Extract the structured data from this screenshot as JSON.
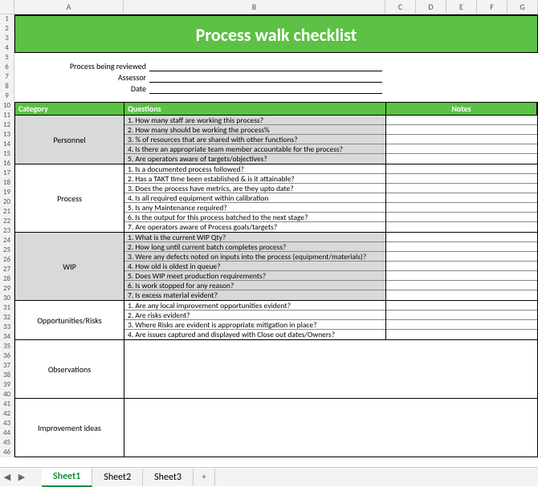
{
  "title": "Process walk checklist",
  "meta": {
    "reviewed_label": "Process being reviewed",
    "assessor_label": "Assessor",
    "date_label": "Date"
  },
  "columns": [
    "A",
    "B",
    "C",
    "D",
    "E",
    "F",
    "G"
  ],
  "rows": [
    "1",
    "2",
    "3",
    "4",
    "5",
    "6",
    "7",
    "8",
    "9",
    "10",
    "11",
    "12",
    "13",
    "14",
    "15",
    "16",
    "17",
    "18",
    "19",
    "20",
    "21",
    "22",
    "23",
    "24",
    "25",
    "26",
    "27",
    "28",
    "29",
    "30",
    "31",
    "32",
    "33",
    "34",
    "35",
    "36",
    "37",
    "38",
    "39",
    "40",
    "41",
    "42",
    "43",
    "44",
    "45",
    "46"
  ],
  "headers": {
    "category": "Category",
    "questions": "Questions",
    "notes": "Notes"
  },
  "sections": [
    {
      "name": "Personnel",
      "shaded": true,
      "questions": [
        "1.  How many staff are working this process?",
        "2.  How many should be working the process%",
        "3. % of resources that are shared with other functions?",
        "4. Is there an appropriate team member accountable for the process?",
        "5. Are operators aware of targets/objectives?"
      ]
    },
    {
      "name": "Process",
      "shaded": false,
      "questions": [
        "1. Is a documented process followed?",
        "2. Has a TAKT time been established & is it attainable?",
        "3. Does the process have metrics, are they upto date?",
        "4. Is all required equipment within calibration",
        "5. Is any Maintenance required?",
        "6. Is the output for this process batched to the next stage?",
        "7. Are operators aware of Process goals/targets?"
      ]
    },
    {
      "name": "WIP",
      "shaded": true,
      "questions": [
        "1.  What is the current WIP Qty?",
        "2. How long until current batch completes process?",
        "3. Were any defects noted on inputs into the process (equipment/materials)?",
        "4. How old is oldest in queue?",
        "5. Does WIP meet production requirements?",
        "6. Is work stopped for any reason?",
        "7. Is excess material evident?"
      ]
    },
    {
      "name": "Opportunities/Risks",
      "shaded": false,
      "questions": [
        "1. Are any local improvement opportunities evident?",
        "2.  Are risks evident?",
        "3. Where Risks are evident is appropriate mitigation in place?",
        "4. Are issues captured and displayed with Close out dates/Owners?"
      ]
    }
  ],
  "freeform": [
    {
      "name": "Observations"
    },
    {
      "name": "Improvement ideas"
    }
  ],
  "tabs": {
    "t1": "Sheet1",
    "t2": "Sheet2",
    "t3": "Sheet3"
  }
}
